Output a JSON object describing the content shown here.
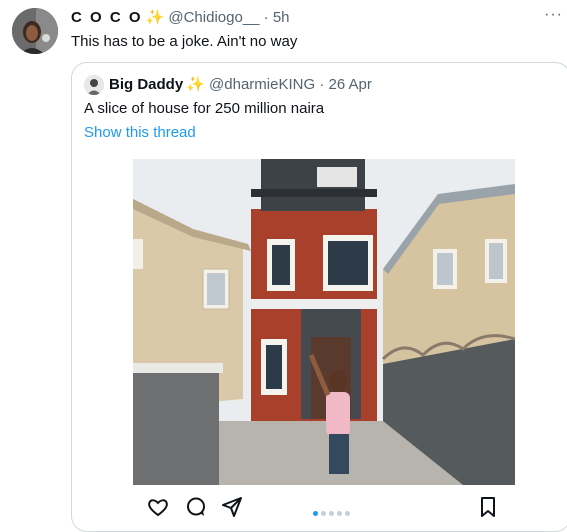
{
  "tweet": {
    "author_name": "C O C O",
    "author_badge": "✨",
    "handle": "@Chidiogo__",
    "separator": "·",
    "time": "5h",
    "more": "···",
    "text": "This has to be a joke. Ain't no way"
  },
  "quoted": {
    "author_name": "Big Daddy",
    "author_badge": "✨",
    "handle": "@dharmieKING",
    "separator": "·",
    "date": "26 Apr",
    "text": "A slice of house for 250 million naira",
    "thread_link": "Show this thread",
    "carousel": {
      "total": 5,
      "active_index": 0
    },
    "actions": [
      "heart-icon",
      "comment-icon",
      "share-icon",
      "bookmark-icon"
    ]
  },
  "colors": {
    "link": "#1d9bf0",
    "muted": "#536471",
    "border": "#cfd9de"
  }
}
